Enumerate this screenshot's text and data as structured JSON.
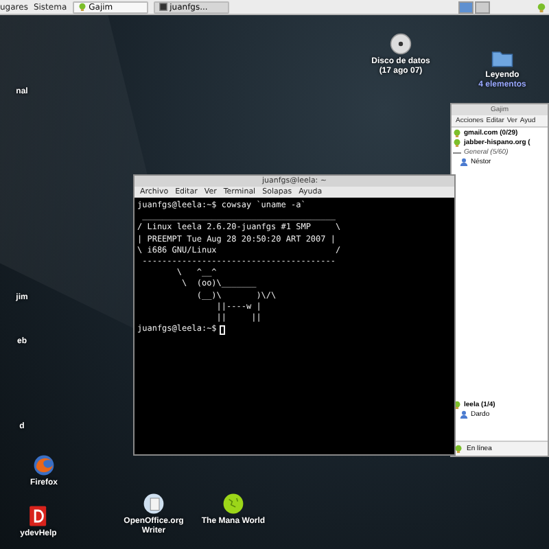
{
  "top_panel": {
    "menus": [
      {
        "label": "ugares"
      },
      {
        "label": "Sistema"
      }
    ],
    "tasks": [
      {
        "label": "Gajim",
        "kind": "gajim",
        "selected": false
      },
      {
        "label": "juanfgs...",
        "kind": "terminal",
        "selected": true
      }
    ],
    "workspaces": [
      {
        "selected": true
      },
      {
        "selected": false
      }
    ]
  },
  "desktop_icons": [
    {
      "kind": "disc",
      "lines": [
        "Disco de datos",
        "(17 ago 07)"
      ]
    },
    {
      "kind": "folder",
      "lines": [
        "Leyendo"
      ],
      "detail": "4 elementos"
    },
    {
      "kind": "none",
      "lines": [
        "nal"
      ]
    },
    {
      "kind": "none",
      "lines": [
        "jim"
      ]
    },
    {
      "kind": "none",
      "lines": [
        "eb"
      ]
    },
    {
      "kind": "none",
      "lines": [
        "d"
      ]
    },
    {
      "kind": "firefox",
      "lines": [
        "Firefox"
      ]
    },
    {
      "kind": "devhelp",
      "lines": [
        "ydevHelp"
      ]
    },
    {
      "kind": "writer",
      "lines": [
        "OpenOffice.org",
        "Writer"
      ]
    },
    {
      "kind": "globe",
      "lines": [
        "The Mana World"
      ]
    }
  ],
  "gajim": {
    "title": "Gajim",
    "menu": [
      "Acciones",
      "Editar",
      "Ver",
      "Ayud"
    ],
    "rows": [
      {
        "kind": "account",
        "label": "gmail.com (0/29)"
      },
      {
        "kind": "account",
        "label": "jabber-hispano.org ("
      },
      {
        "kind": "group",
        "label": "General (5/60)"
      },
      {
        "kind": "contact",
        "label": "Néstor"
      },
      {
        "kind": "account",
        "label": "leela (1/4)"
      },
      {
        "kind": "contact",
        "label": "Dardo"
      }
    ],
    "status": "En línea"
  },
  "terminal": {
    "title": "juanfgs@leela: ~",
    "menu": [
      "Archivo",
      "Editar",
      "Ver",
      "Terminal",
      "Solapas",
      "Ayuda"
    ],
    "lines": [
      {
        "kind": "text",
        "text": "juanfgs@leela:~$ cowsay `uname -a`"
      },
      {
        "kind": "text",
        "text": " _______________________________________"
      },
      {
        "kind": "text",
        "text": "/ Linux leela 2.6.20-juanfgs #1 SMP     \\"
      },
      {
        "kind": "text",
        "text": "| PREEMPT Tue Aug 28 20:50:20 ART 2007 |"
      },
      {
        "kind": "text",
        "text": "\\ i686 GNU/Linux                        /"
      },
      {
        "kind": "text",
        "text": " ---------------------------------------"
      },
      {
        "kind": "text",
        "text": "        \\   ^__^"
      },
      {
        "kind": "text",
        "text": "         \\  (oo)\\_______"
      },
      {
        "kind": "text",
        "text": "            (__)\\       )\\/\\"
      },
      {
        "kind": "text",
        "text": "                ||----w |"
      },
      {
        "kind": "text",
        "text": "                ||     ||"
      },
      {
        "kind": "prompt",
        "text": "juanfgs@leela:~$"
      }
    ]
  }
}
